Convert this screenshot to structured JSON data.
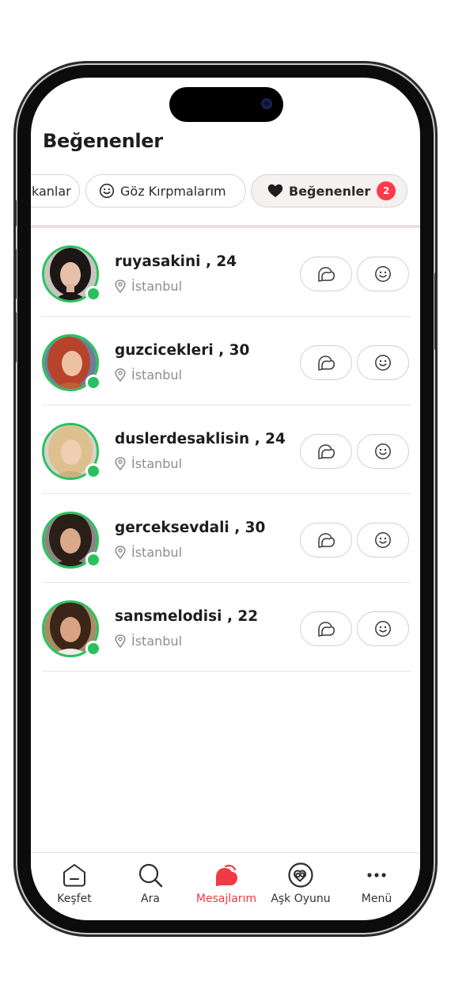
{
  "header": {
    "title": "Beğenenler"
  },
  "chips": [
    {
      "label": "kanlar",
      "active": false
    },
    {
      "label": "Göz Kırpmalarım",
      "icon": "smiley-icon",
      "active": false
    },
    {
      "label": "Beğenenler",
      "icon": "heart-icon",
      "active": true,
      "badge": "2"
    }
  ],
  "users": [
    {
      "name": "ruyasakini",
      "age": ", 24",
      "location": "İstanbul",
      "online": true
    },
    {
      "name": "guzcicekleri",
      "age": ", 30",
      "location": "İstanbul",
      "online": true
    },
    {
      "name": "duslerdesaklisin",
      "age": ", 24",
      "location": "İstanbul",
      "online": true
    },
    {
      "name": "gerceksevdali",
      "age": ", 30",
      "location": "İstanbul",
      "online": true
    },
    {
      "name": "sansmelodisi",
      "age": ", 22",
      "location": "İstanbul",
      "online": true
    }
  ],
  "tabbar": [
    {
      "label": "Keşfet",
      "icon": "home-icon",
      "active": false
    },
    {
      "label": "Ara",
      "icon": "search-icon",
      "active": false
    },
    {
      "label": "Mesajlarım",
      "icon": "chat-bubble-icon",
      "active": true
    },
    {
      "label": "Aşk Oyunu",
      "icon": "love-game-icon",
      "active": false
    },
    {
      "label": "Menü",
      "icon": "more-dots-icon",
      "active": false
    }
  ],
  "colors": {
    "accent": "#f03a46",
    "online": "#29c15f",
    "badge": "#ff3b47"
  }
}
